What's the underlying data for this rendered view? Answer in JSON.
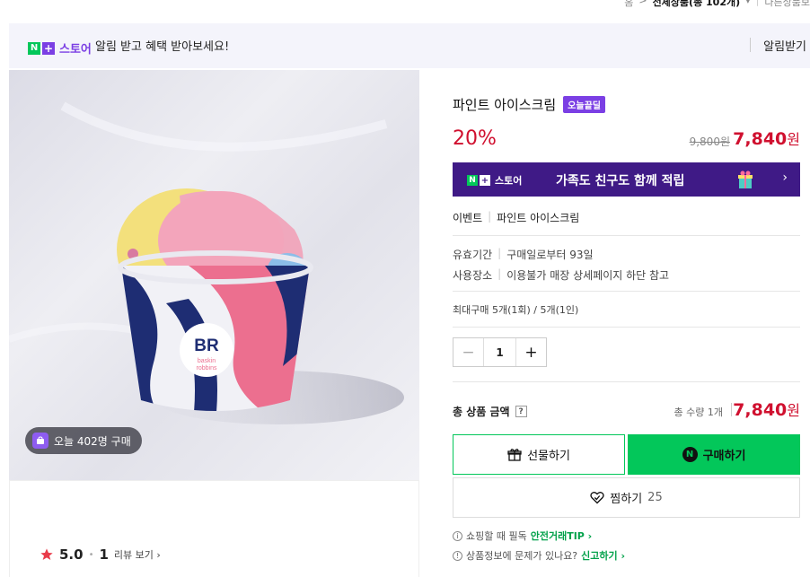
{
  "topbar": {
    "home": "홈",
    "arrow": ">",
    "category": "전체상품(총 102개)",
    "caret": "▾",
    "other": "다른상품보"
  },
  "banner": {
    "n_label": "N",
    "plus_label": "+",
    "store_label": "스토어",
    "message": "알림 받고 혜택 받아보세요!",
    "alarm_label": "알림받기"
  },
  "image": {
    "brand_initials": "BR",
    "brand_line1": "baskin",
    "brand_line2": "robbins",
    "buy_count": "오늘 402명 구매"
  },
  "rating": {
    "score": "5.0",
    "dot": "•",
    "count": "1",
    "review_label": "리뷰 보기 ›"
  },
  "product": {
    "title": "파인트 아이스크림",
    "deal_badge": "오늘끝딜",
    "discount": "20%",
    "original_price": "9,800원",
    "sale_price": "7,840",
    "won": "원"
  },
  "promo": {
    "n_label": "N",
    "plus_label": "+",
    "store_label": "스토어",
    "text": "가족도 친구도 함께 적립",
    "chevron": "›"
  },
  "event": {
    "label": "이벤트",
    "sep": "|",
    "value": "파인트 아이스크림"
  },
  "info": {
    "expiry_label": "유효기간",
    "expiry_value": "구매일로부터 93일",
    "place_label": "사용장소",
    "place_value": "이용불가 매장 상세페이지 하단 참고",
    "sep": "|",
    "max_purchase": "최대구매 5개(1회) / 5개(1인)"
  },
  "quantity": {
    "minus": "−",
    "value": "1",
    "plus": "+"
  },
  "total": {
    "label": "총 상품 금액",
    "help": "?",
    "qty_text": "총 수량 1개",
    "price": "7,840",
    "won": "원"
  },
  "buttons": {
    "gift": "선물하기",
    "buy": "구매하기",
    "n_icon": "N",
    "wish": "찜하기",
    "wish_count": "25"
  },
  "tips": [
    {
      "icon": "i",
      "text": "쇼핑할 때 필독",
      "link": "안전거래TIP ›"
    },
    {
      "icon": "!",
      "text": "상품정보에 문제가 있나요?",
      "link": "신고하기 ›"
    }
  ]
}
